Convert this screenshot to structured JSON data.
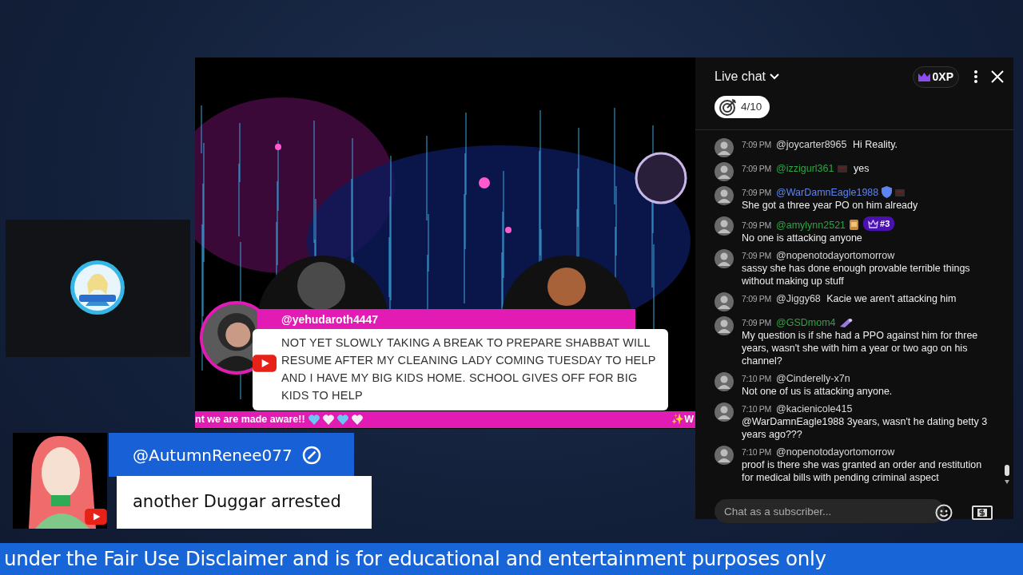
{
  "video": {
    "featured_comment": {
      "author": "@yehudaroth4447",
      "text": "NOT YET SLOWLY TAKING A BREAK TO PREPARE SHABBAT WILL RESUME AFTER MY CLEANING LADY COMING TUESDAY TO HELP AND I HAVE MY BIG KIDS HOME. SCHOOL GIVES OFF FOR BIG KIDS TO HELP"
    },
    "ticker": {
      "text": "nt we are made aware!!",
      "hearts": [
        {
          "color": "#6cc8f2"
        },
        {
          "color": "#f3eef6"
        },
        {
          "color": "#6cc8f2"
        },
        {
          "color": "#f3eef6"
        }
      ],
      "end_text": "✨W"
    }
  },
  "live_chat": {
    "title": "Live chat",
    "xp": "0XP",
    "goal": "4/10",
    "messages": [
      {
        "time": "7:09 PM",
        "author": "@joycarter8965",
        "color": "#d8d8d8",
        "text": "Hi Reality."
      },
      {
        "time": "7:09 PM",
        "author": "@izzigurl361",
        "color": "#2ba640",
        "badges": [
          {
            "kind": "member"
          }
        ],
        "text": "yes"
      },
      {
        "time": "7:09 PM",
        "author": "@WarDamnEagle1988",
        "color": "#5e84f1",
        "badges": [
          {
            "kind": "moderator"
          },
          {
            "kind": "member"
          }
        ],
        "text": "She got a three year PO on him already"
      },
      {
        "time": "7:09 PM",
        "author": "@amylynn2521",
        "color": "#2ba640",
        "badges": [
          {
            "kind": "gift"
          },
          {
            "kind": "rank",
            "label": "#3"
          }
        ],
        "text": "No one is attacking anyone"
      },
      {
        "time": "7:09 PM",
        "author": "@nopenotodayortomorrow",
        "color": "#d8d8d8",
        "text": "sassy she has done enough provable terrible things without making up stuff"
      },
      {
        "time": "7:09 PM",
        "author": "@Jiggy68",
        "color": "#d8d8d8",
        "text": "Kacie we aren't attacking him"
      },
      {
        "time": "7:09 PM",
        "author": "@GSDmom4",
        "color": "#2ba640",
        "badges": [
          {
            "kind": "emote"
          }
        ],
        "text": "My question is if she had a PPO against him for three years, wasn't she with him a year or two ago on his channel?"
      },
      {
        "time": "7:10 PM",
        "author": "@Cinderelly-x7n",
        "color": "#d8d8d8",
        "text": "Not one of us is attacking anyone."
      },
      {
        "time": "7:10 PM",
        "author": "@kacienicole415",
        "color": "#d8d8d8",
        "text": "@WarDamnEagle1988 3years, wasn't he dating betty 3 years ago???"
      },
      {
        "time": "7:10 PM",
        "author": "@nopenotodayortomorrow",
        "color": "#d8d8d8",
        "text": "proof is there she was granted an order and restitution for medical bills with pending criminal aspect"
      }
    ],
    "input": {
      "placeholder": "Chat as a subscriber..."
    }
  },
  "overlay_comment": {
    "author": "@AutumnRenee077",
    "text": "another Duggar arrested"
  },
  "disclaimer_bar": {
    "text": "under the Fair Use Disclaimer and is for educational and entertainment purposes only"
  }
}
